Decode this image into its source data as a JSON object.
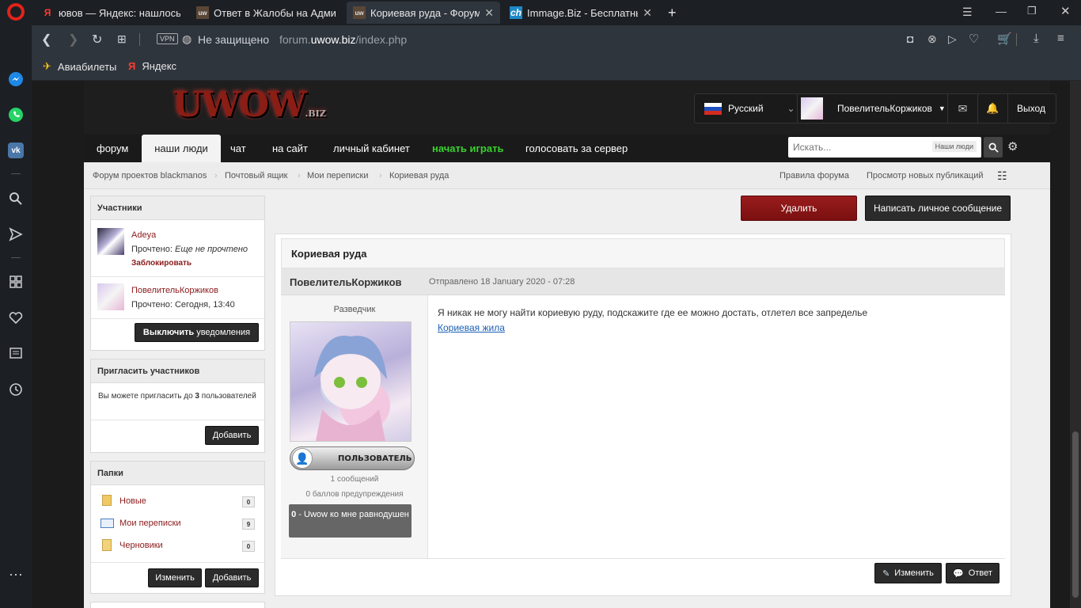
{
  "browser": {
    "tabs": [
      {
        "icon": "Я",
        "label": "ювов — Яндекс: нашлось",
        "active": false
      },
      {
        "icon": "uw",
        "label": "Ответ в Жалобы на Адми",
        "active": false
      },
      {
        "icon": "uw",
        "label": "Кориевая руда - Форум пр",
        "active": true
      },
      {
        "icon": "ch",
        "label": "Immage.Biz - Бесплатный",
        "active": false
      }
    ],
    "new_tab": "+",
    "vpn_label": "VPN",
    "security_label": "Не защищено",
    "url_domain": "forum.uwow.biz",
    "url_path": "/index.php",
    "url_prefix": "forum.",
    "url_main": "uwow.biz",
    "bookmarks": [
      {
        "icon": "plane-icon",
        "label": "Авиабилеты"
      },
      {
        "icon": "yandex-icon",
        "label": "Яндекс"
      }
    ]
  },
  "header": {
    "logo_text": "UWOW",
    "logo_suffix": ".BIZ",
    "language": "Русский",
    "username": "ПовелительКоржиков",
    "logout": "Выход"
  },
  "menu": {
    "items": [
      "форум",
      "наши люди",
      "чат",
      "на сайт",
      "личный кабинет",
      "начать играть",
      "голосовать за сервер"
    ],
    "search_placeholder": "Искать...",
    "search_scope": "Наши люди"
  },
  "breadcrumb": {
    "items": [
      "Форум проектов blackmanos",
      "Почтовый ящик",
      "Мои переписки",
      "Кориевая руда"
    ],
    "right_links": [
      "Правила форума",
      "Просмотр новых публикаций"
    ]
  },
  "participants": {
    "title": "Участники",
    "users": [
      {
        "name": "Adeya",
        "read_label": "Прочтено:",
        "read_value": "Еще не прочтено",
        "action": "Заблокировать"
      },
      {
        "name": "ПовелительКоржиков",
        "read_label": "Прочтено:",
        "read_value": "Сегодня, 13:40"
      }
    ],
    "notify_btn_bold": "Выключить",
    "notify_btn_rest": " уведомления"
  },
  "invite": {
    "title": "Пригласить участников",
    "text_before": "Вы можете пригласить до ",
    "text_count": "3",
    "text_after": " пользователей",
    "add_btn": "Добавить"
  },
  "folders": {
    "title": "Папки",
    "items": [
      {
        "label": "Новые",
        "count": "0"
      },
      {
        "label": "Мои переписки",
        "count": "9"
      },
      {
        "label": "Черновики",
        "count": "0"
      }
    ],
    "edit_btn": "Изменить",
    "add_btn": "Добавить"
  },
  "actions": {
    "delete_btn": "Удалить",
    "pm_btn": "Написать личное сообщение"
  },
  "topic": {
    "title": "Кориевая руда",
    "author": "ПовелительКоржиков",
    "sent": "Отправлено 18 January 2020 - 07:28",
    "rank": "Разведчик",
    "group_badge": "ПОЛЬЗОВАТЕЛЬ",
    "posts_count": "1 сообщений",
    "warnings": "0 баллов предупреждения",
    "rep_value": "0",
    "rep_text": " - Uwow ко мне равнодушен",
    "body": "Я никак не могу найти кориевую руду, подскажите где ее можно достать, отлетел все запределье",
    "link": "Кориевая жила",
    "edit_btn": "Изменить",
    "reply_btn": "Ответ"
  },
  "colors": {
    "accent_red": "#8b1a1a",
    "menu_green": "#3ad12f",
    "link_blue": "#1b5fb5"
  }
}
